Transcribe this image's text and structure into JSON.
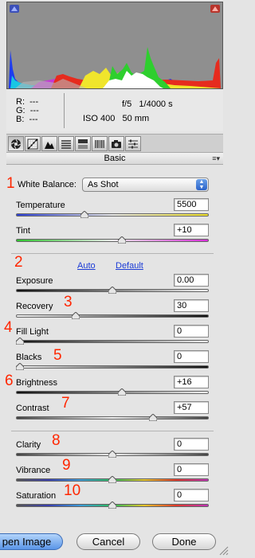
{
  "info": {
    "r_label": "R:",
    "r_value": "---",
    "g_label": "G:",
    "g_value": "---",
    "b_label": "B:",
    "b_value": "---",
    "aperture": "f/5",
    "shutter": "1/4000 s",
    "iso": "ISO 400",
    "focal": "50 mm"
  },
  "toolbar": {
    "icons": [
      "basic-icon",
      "tone-curve-icon",
      "detail-icon",
      "hsl-icon",
      "split-toning-icon",
      "lens-icon",
      "camera-calibration-icon",
      "presets-icon"
    ]
  },
  "panel": {
    "title": "Basic"
  },
  "white_balance": {
    "label": "White Balance:",
    "value": "As Shot"
  },
  "controls": {
    "temperature": {
      "label": "Temperature",
      "value": "5500",
      "position": 0.35
    },
    "tint": {
      "label": "Tint",
      "value": "+10",
      "position": 0.55
    },
    "exposure": {
      "label": "Exposure",
      "value": "0.00",
      "position": 0.5
    },
    "recovery": {
      "label": "Recovery",
      "value": "30",
      "position": 0.3
    },
    "fill_light": {
      "label": "Fill Light",
      "value": "0",
      "position": 0.0
    },
    "blacks": {
      "label": "Blacks",
      "value": "0",
      "position": 0.0
    },
    "brightness": {
      "label": "Brightness",
      "value": "+16",
      "position": 0.55
    },
    "contrast": {
      "label": "Contrast",
      "value": "+57",
      "position": 0.72
    },
    "clarity": {
      "label": "Clarity",
      "value": "0",
      "position": 0.5
    },
    "vibrance": {
      "label": "Vibrance",
      "value": "0",
      "position": 0.5
    },
    "saturation": {
      "label": "Saturation",
      "value": "0",
      "position": 0.5
    }
  },
  "links": {
    "auto": "Auto",
    "default": "Default"
  },
  "annotations": [
    "1",
    "2",
    "3",
    "4",
    "5",
    "6",
    "7",
    "8",
    "9",
    "10"
  ],
  "buttons": {
    "open": "pen Image",
    "cancel": "Cancel",
    "done": "Done"
  },
  "colors": {
    "annotation": "#ff2600",
    "link": "#1b3bd6",
    "primary_button": "#5a95e8"
  }
}
